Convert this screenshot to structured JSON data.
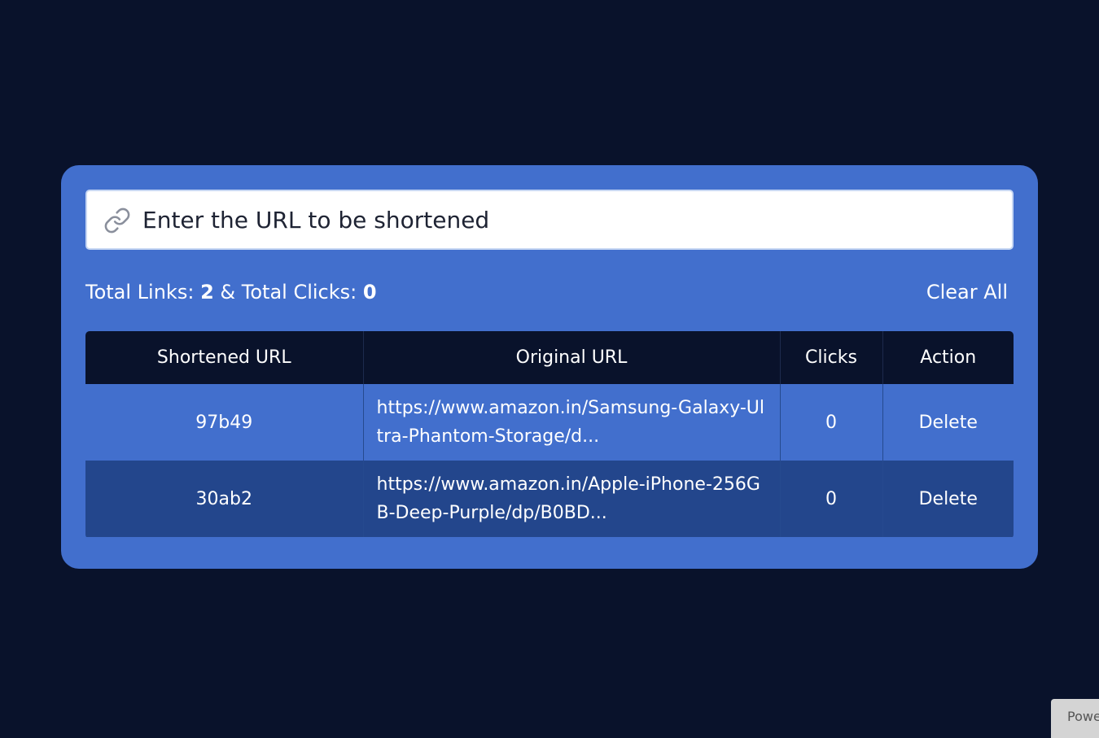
{
  "input": {
    "placeholder": "Enter the URL to be shortened"
  },
  "stats": {
    "links_label": "Total Links:",
    "links_value": "2",
    "separator": "&",
    "clicks_label": "Total Clicks:",
    "clicks_value": "0",
    "clear_all_label": "Clear All"
  },
  "table": {
    "headers": [
      "Shortened URL",
      "Original URL",
      "Clicks",
      "Action"
    ],
    "rows": [
      {
        "short": "97b49",
        "original": "https://www.amazon.in/Samsung-Galaxy-Ultra-Phantom-Storage/d...",
        "clicks": "0",
        "action": "Delete"
      },
      {
        "short": "30ab2",
        "original": "https://www.amazon.in/Apple-iPhone-256GB-Deep-Purple/dp/B0BD...",
        "clicks": "0",
        "action": "Delete"
      }
    ]
  },
  "footer": {
    "powered_label": "Powe"
  },
  "colors": {
    "page_bg": "#09122b",
    "card_bg": "#426fcd",
    "row_alt_bg": "#23468c",
    "header_bg": "#09122b"
  },
  "icons": {
    "input_icon": "link-icon"
  }
}
